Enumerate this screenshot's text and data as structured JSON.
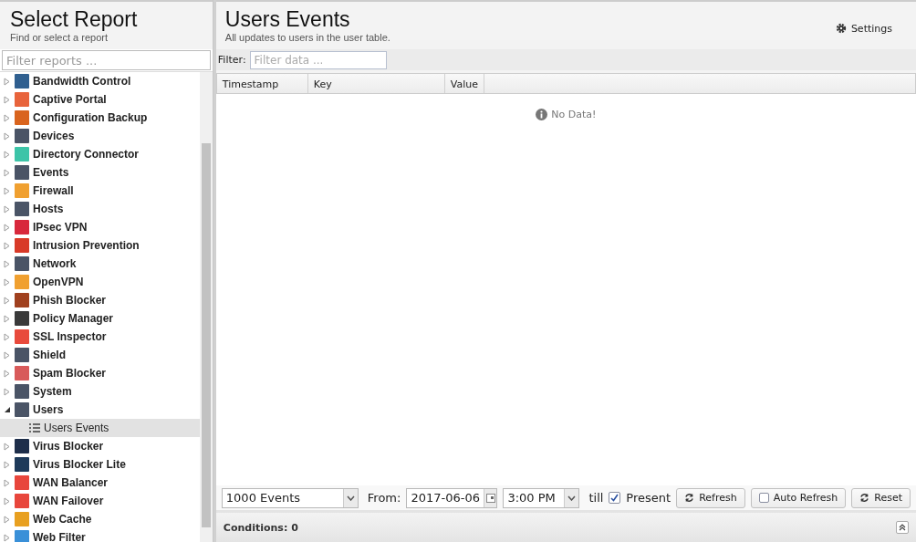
{
  "sidebar": {
    "title": "Select Report",
    "subtitle": "Find or select a report",
    "filter": {
      "placeholder": "Filter reports ..."
    },
    "items": [
      {
        "label": "Bandwidth Control",
        "color": "#2f5f8f",
        "expanded": false,
        "selected": false
      },
      {
        "label": "Captive Portal",
        "color": "#e8643c",
        "expanded": false,
        "selected": false
      },
      {
        "label": "Configuration Backup",
        "color": "#d9641e",
        "expanded": false,
        "selected": false
      },
      {
        "label": "Devices",
        "color": "#4a5466",
        "expanded": false,
        "selected": false
      },
      {
        "label": "Directory Connector",
        "color": "#3cc4a8",
        "expanded": false,
        "selected": false
      },
      {
        "label": "Events",
        "color": "#4a5466",
        "expanded": false,
        "selected": false
      },
      {
        "label": "Firewall",
        "color": "#f0a030",
        "expanded": false,
        "selected": false
      },
      {
        "label": "Hosts",
        "color": "#4a5466",
        "expanded": false,
        "selected": false
      },
      {
        "label": "IPsec VPN",
        "color": "#d8283c",
        "expanded": false,
        "selected": false
      },
      {
        "label": "Intrusion Prevention",
        "color": "#d83a28",
        "expanded": false,
        "selected": false
      },
      {
        "label": "Network",
        "color": "#4a5466",
        "expanded": false,
        "selected": false
      },
      {
        "label": "OpenVPN",
        "color": "#f0a030",
        "expanded": false,
        "selected": false
      },
      {
        "label": "Phish Blocker",
        "color": "#a0401e",
        "expanded": false,
        "selected": false
      },
      {
        "label": "Policy Manager",
        "color": "#3a3a3a",
        "expanded": false,
        "selected": false
      },
      {
        "label": "SSL Inspector",
        "color": "#e84a3c",
        "expanded": false,
        "selected": false
      },
      {
        "label": "Shield",
        "color": "#4a5466",
        "expanded": false,
        "selected": false
      },
      {
        "label": "Spam Blocker",
        "color": "#d85a5a",
        "expanded": false,
        "selected": false
      },
      {
        "label": "System",
        "color": "#4a5466",
        "expanded": false,
        "selected": false
      },
      {
        "label": "Users",
        "color": "#4a5466",
        "expanded": true,
        "selected": false,
        "children": [
          {
            "label": "Users Events",
            "selected": true
          }
        ]
      },
      {
        "label": "Virus Blocker",
        "color": "#1e2e4a",
        "expanded": false,
        "selected": false
      },
      {
        "label": "Virus Blocker Lite",
        "color": "#1e3a5a",
        "expanded": false,
        "selected": false
      },
      {
        "label": "WAN Balancer",
        "color": "#e8463c",
        "expanded": false,
        "selected": false
      },
      {
        "label": "WAN Failover",
        "color": "#e8463c",
        "expanded": false,
        "selected": false
      },
      {
        "label": "Web Cache",
        "color": "#e8a020",
        "expanded": false,
        "selected": false
      },
      {
        "label": "Web Filter",
        "color": "#3a90d8",
        "expanded": false,
        "selected": false
      }
    ]
  },
  "main": {
    "title": "Users Events",
    "subtitle": "All updates to users in the user table.",
    "settings": "Settings",
    "filter": {
      "label": "Filter:",
      "placeholder": "Filter data ..."
    },
    "table": {
      "columns": [
        "Timestamp",
        "Key",
        "Value"
      ],
      "empty": "No Data!"
    },
    "toolbar": {
      "limit": "1000 Events",
      "from_label": "From:",
      "date": "2017-06-06",
      "time": "3:00 PM",
      "till": "till",
      "present": {
        "label": "Present",
        "checked": true
      },
      "buttons": [
        {
          "label": "Refresh",
          "kind": "refresh"
        },
        {
          "label": "Auto Refresh",
          "kind": "toggle",
          "checked": false
        },
        {
          "label": "Reset",
          "kind": "refresh"
        }
      ]
    },
    "conditions": "Conditions: 0"
  }
}
